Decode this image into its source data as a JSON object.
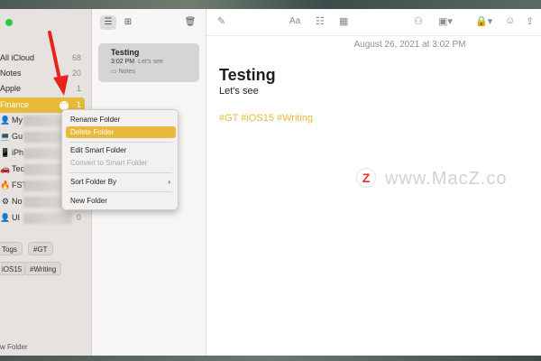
{
  "sidebar": {
    "traffic_light_color": "#2fc84a",
    "items": [
      {
        "label": "All iCloud",
        "count": "68"
      },
      {
        "label": "Notes",
        "count": "20"
      },
      {
        "label": "Apple",
        "count": "1"
      },
      {
        "label": "Finance",
        "count": "1"
      }
    ],
    "smart_folders": [
      {
        "icon": "person-icon",
        "label": "My"
      },
      {
        "icon": "laptop-icon",
        "label": "Gu"
      },
      {
        "icon": "phone-icon",
        "label": "iPh"
      },
      {
        "icon": "car-icon",
        "label": "Tec"
      },
      {
        "icon": "fire-icon",
        "label": "FST"
      },
      {
        "icon": "gear-icon",
        "label": "No"
      },
      {
        "icon": "person-icon",
        "label": "UI",
        "count": "0"
      }
    ],
    "tags": [
      "Togs",
      "#GT",
      "iOS15",
      "#Writing"
    ],
    "new_folder_label": "w Folder"
  },
  "note_list": {
    "note": {
      "title": "Testing",
      "time": "3:02 PM",
      "preview": "Let's see",
      "folder": "Notes"
    }
  },
  "editor": {
    "date": "August 26, 2021 at 3:02 PM",
    "title": "Testing",
    "subtitle": "Let's see",
    "tags_line": "#GT #iOS15 #Writing",
    "font_button": "Aa"
  },
  "context_menu": {
    "items": [
      {
        "label": "Rename Folder"
      },
      {
        "label": "Delete Folder"
      },
      {
        "label": "Edit Smart Folder"
      },
      {
        "label": "Convert to Smart Folder"
      },
      {
        "label": "Sort Folder By"
      },
      {
        "label": "New Folder"
      }
    ]
  },
  "watermark": {
    "logo_letter": "Z",
    "text": "www.MacZ.co"
  },
  "colors": {
    "accent": "#e8b93a",
    "arrow": "#e8231c",
    "sidebar_bg": "#e6e2df"
  }
}
